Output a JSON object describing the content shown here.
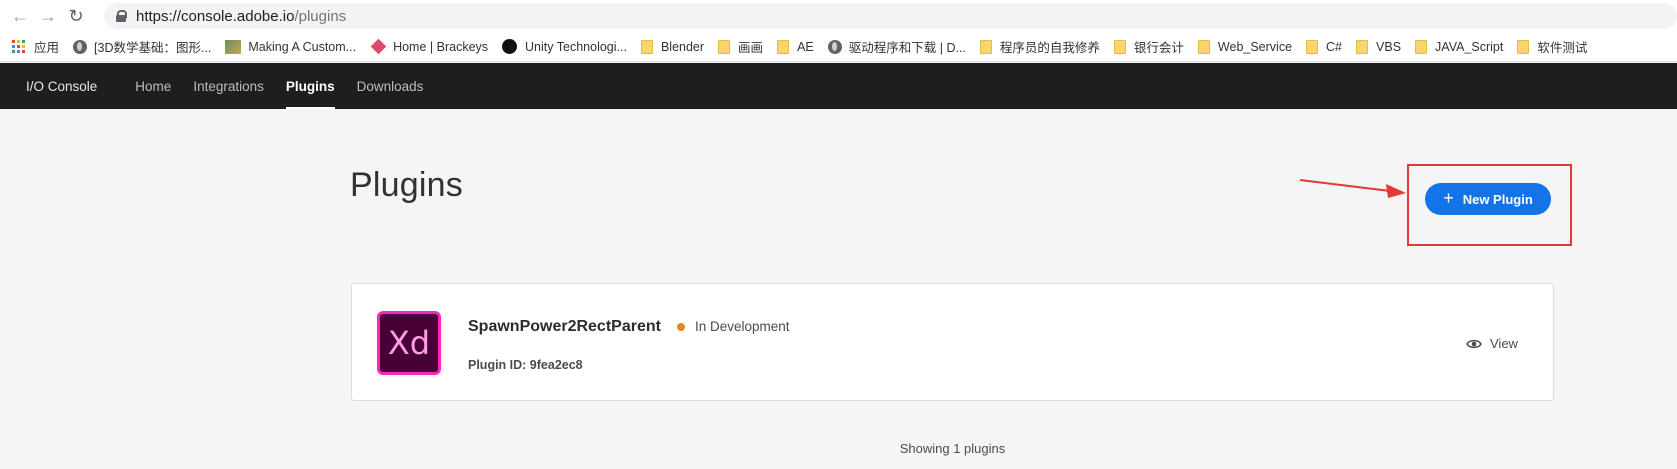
{
  "browser": {
    "url_host": "https://console.adobe.io",
    "url_path": "/plugins",
    "bookmarks": [
      {
        "label": "应用",
        "icon": "apps-grid-icon"
      },
      {
        "label": "[3D数学基础：图形...",
        "icon": "globe-icon"
      },
      {
        "label": "Making A Custom...",
        "icon": "image-icon"
      },
      {
        "label": "Home | Brackeys",
        "icon": "diamond-icon"
      },
      {
        "label": "Unity Technologi...",
        "icon": "github-icon"
      },
      {
        "label": "Blender",
        "icon": "folder-icon"
      },
      {
        "label": "画画",
        "icon": "folder-icon"
      },
      {
        "label": "AE",
        "icon": "folder-icon"
      },
      {
        "label": "驱动程序和下载 | D...",
        "icon": "globe-icon"
      },
      {
        "label": "程序员的自我修养",
        "icon": "folder-icon"
      },
      {
        "label": "银行会计",
        "icon": "folder-icon"
      },
      {
        "label": "Web_Service",
        "icon": "folder-icon"
      },
      {
        "label": "C#",
        "icon": "folder-icon"
      },
      {
        "label": "VBS",
        "icon": "folder-icon"
      },
      {
        "label": "JAVA_Script",
        "icon": "folder-icon"
      },
      {
        "label": "软件测试",
        "icon": "folder-icon"
      }
    ]
  },
  "nav": {
    "brand": "I/O Console",
    "items": [
      {
        "label": "Home"
      },
      {
        "label": "Integrations"
      },
      {
        "label": "Plugins"
      },
      {
        "label": "Downloads"
      }
    ],
    "selected": "Plugins"
  },
  "main": {
    "title": "Plugins",
    "new_plugin_label": "New Plugin",
    "plugin": {
      "logo_text": "Xd",
      "name": "SpawnPower2RectParent",
      "status": "In Development",
      "id_label": "Plugin ID: 9fea2ec8",
      "view_label": "View"
    },
    "count_text": "Showing 1 plugins"
  },
  "colors": {
    "accent": "#1473e6",
    "status": "#e68619",
    "annotation": "#e53935"
  }
}
